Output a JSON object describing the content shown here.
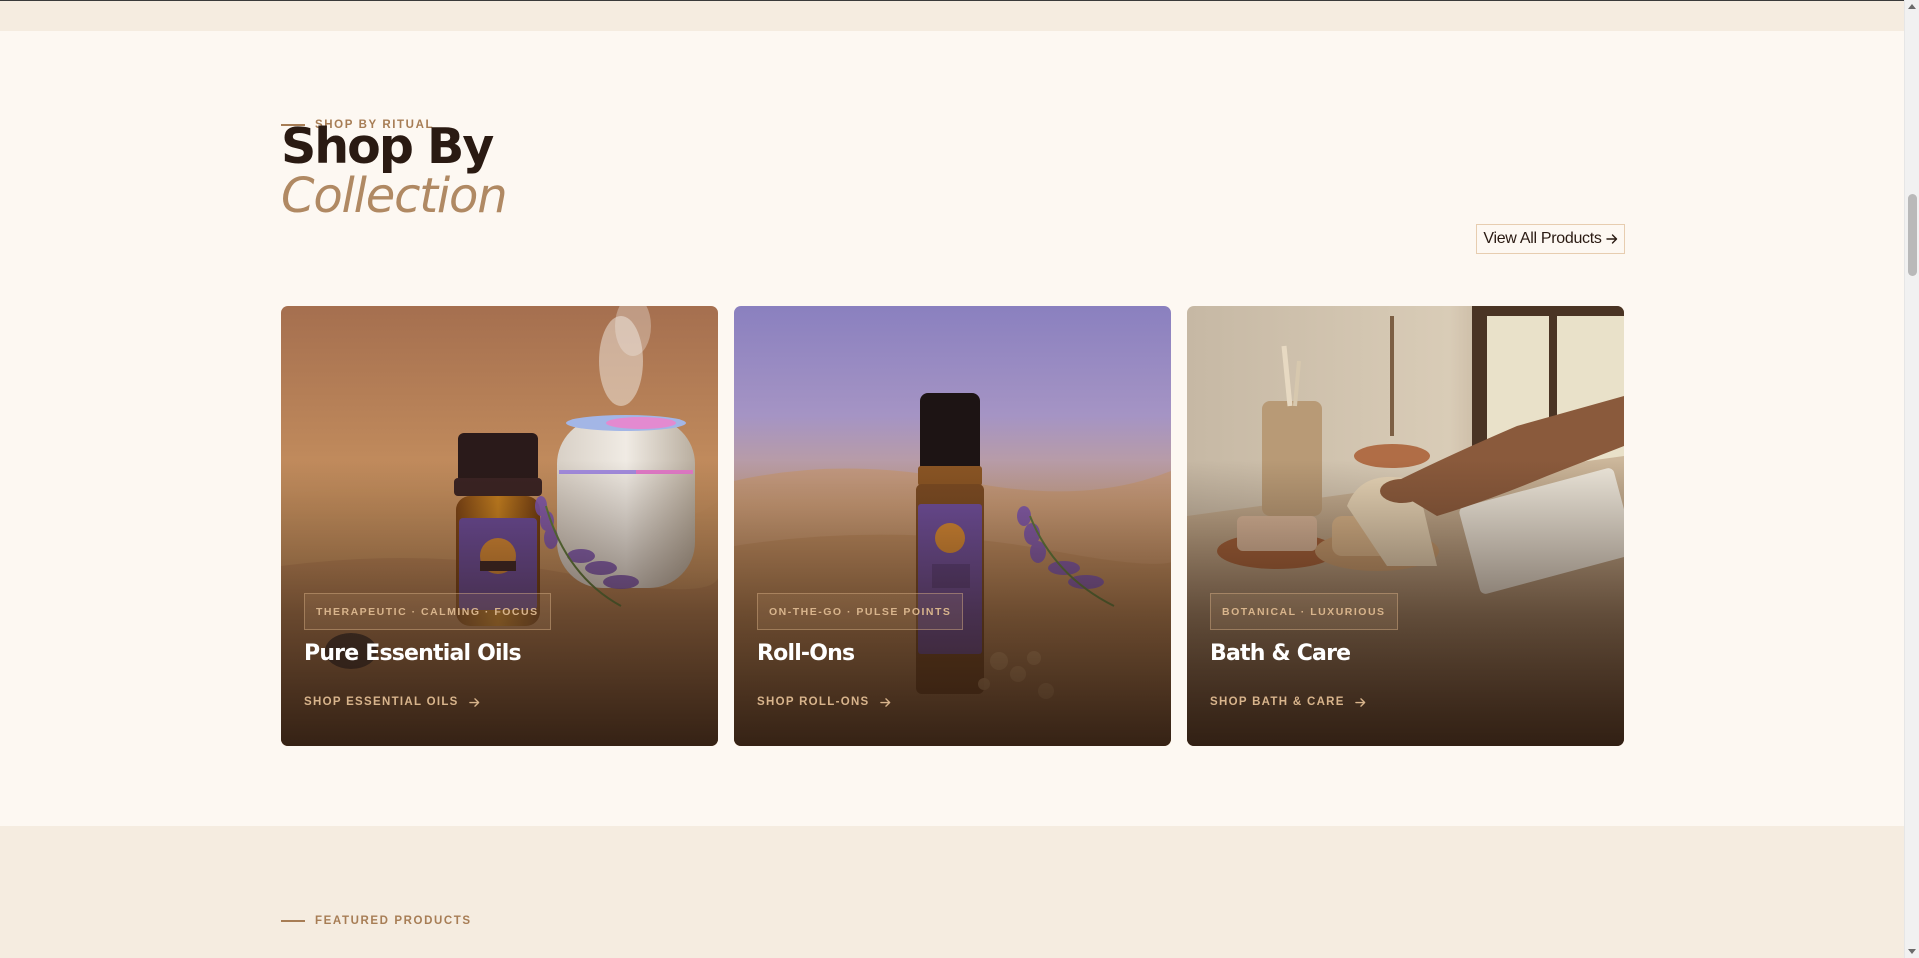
{
  "ritual": {
    "eyebrow": "SHOP BY RITUAL",
    "heading_line1": "Shop By",
    "heading_line2": "Collection",
    "view_all_label": "View All Products"
  },
  "cards": [
    {
      "tag": "THERAPEUTIC · CALMING · FOCUS",
      "title": "Pure Essential Oils",
      "cta": "SHOP ESSENTIAL OILS",
      "image": "essential-oil-bottle-diffuser-lavender-desert"
    },
    {
      "tag": "ON-THE-GO · PULSE POINTS",
      "title": "Roll-Ons",
      "cta": "SHOP ROLL-ONS",
      "image": "rollon-bottle-lavender-desert"
    },
    {
      "tag": "BOTANICAL · LUXURIOUS",
      "title": "Bath & Care",
      "cta": "SHOP BATH & CARE",
      "image": "bath-accessories-soap-brush-windowsill"
    }
  ],
  "featured": {
    "eyebrow": "FEATURED PRODUCTS"
  },
  "colors": {
    "accent": "#a77d55",
    "heading": "#2a1a12",
    "italic": "#b08963",
    "background": "#fdf8f2",
    "band": "#f5ece0"
  },
  "icons": {
    "arrow": "arrow-right-icon",
    "scroll_up": "scroll-up-icon",
    "scroll_down": "scroll-down-icon"
  }
}
